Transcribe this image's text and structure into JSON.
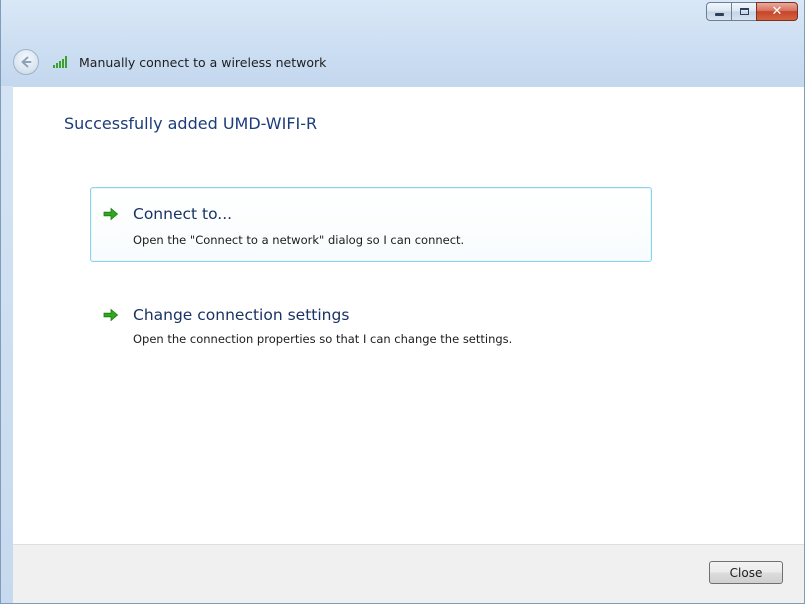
{
  "window": {
    "title": "Manually connect to a wireless network",
    "caption_buttons": {
      "minimize": "minimize-icon",
      "maximize": "maximize-icon",
      "close": "close-icon"
    }
  },
  "content": {
    "heading": "Successfully added UMD-WIFI-R",
    "options": [
      {
        "title": "Connect to...",
        "description": "Open the \"Connect to a network\" dialog so I can connect."
      },
      {
        "title": "Change connection settings",
        "description": "Open the connection properties so that I can change the settings."
      }
    ]
  },
  "footer": {
    "close_label": "Close"
  },
  "colors": {
    "heading": "#1c3c7a",
    "link_title": "#1a3264",
    "hover_border": "#8ad4ec",
    "arrow_green": "#2fa81e"
  }
}
